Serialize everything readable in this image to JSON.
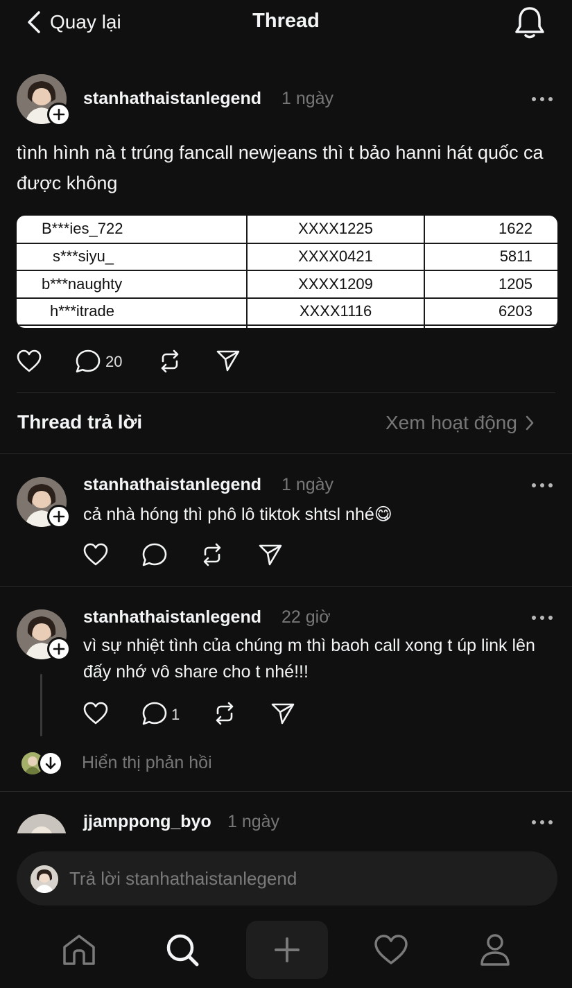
{
  "header": {
    "back_label": "Quay lại",
    "title": "Thread"
  },
  "post": {
    "username": "stanhathaistanlegend",
    "time": "1 ngày",
    "text": "tình hình nà t trúng fancall newjeans thì t bảo hanni hát quốc ca được không",
    "table": {
      "rows": [
        [
          "B***ies_722",
          "XXXX1225",
          "1622"
        ],
        [
          "s***siyu_",
          "XXXX0421",
          "5811"
        ],
        [
          "b***naughty",
          "XXXX1209",
          "1205"
        ],
        [
          "h***itrade",
          "XXXX1116",
          "6203"
        ]
      ]
    },
    "reply_count": "20"
  },
  "replies_section": {
    "title": "Thread trả lời",
    "view_activity": "Xem hoạt động"
  },
  "replies": [
    {
      "username": "stanhathaistanlegend",
      "time": "1 ngày",
      "text": "cả nhà hóng thì phô lô tiktok shtsl nhé😋"
    },
    {
      "username": "stanhathaistanlegend",
      "time": "22 giờ",
      "text": "vì sự nhiệt tình của chúng m thì baoh call xong t úp link lên đấy nhớ vô share cho t nhé!!!",
      "reply_count": "1",
      "show_replies": "Hiển thị phản hồi"
    },
    {
      "username": "jjamppong_byo",
      "time": "1 ngày"
    }
  ],
  "composer": {
    "placeholder": "Trả lời stanhathaistanlegend"
  },
  "nav": [
    "home-icon",
    "search-icon",
    "create-icon",
    "activity-heart-icon",
    "profile-icon"
  ]
}
